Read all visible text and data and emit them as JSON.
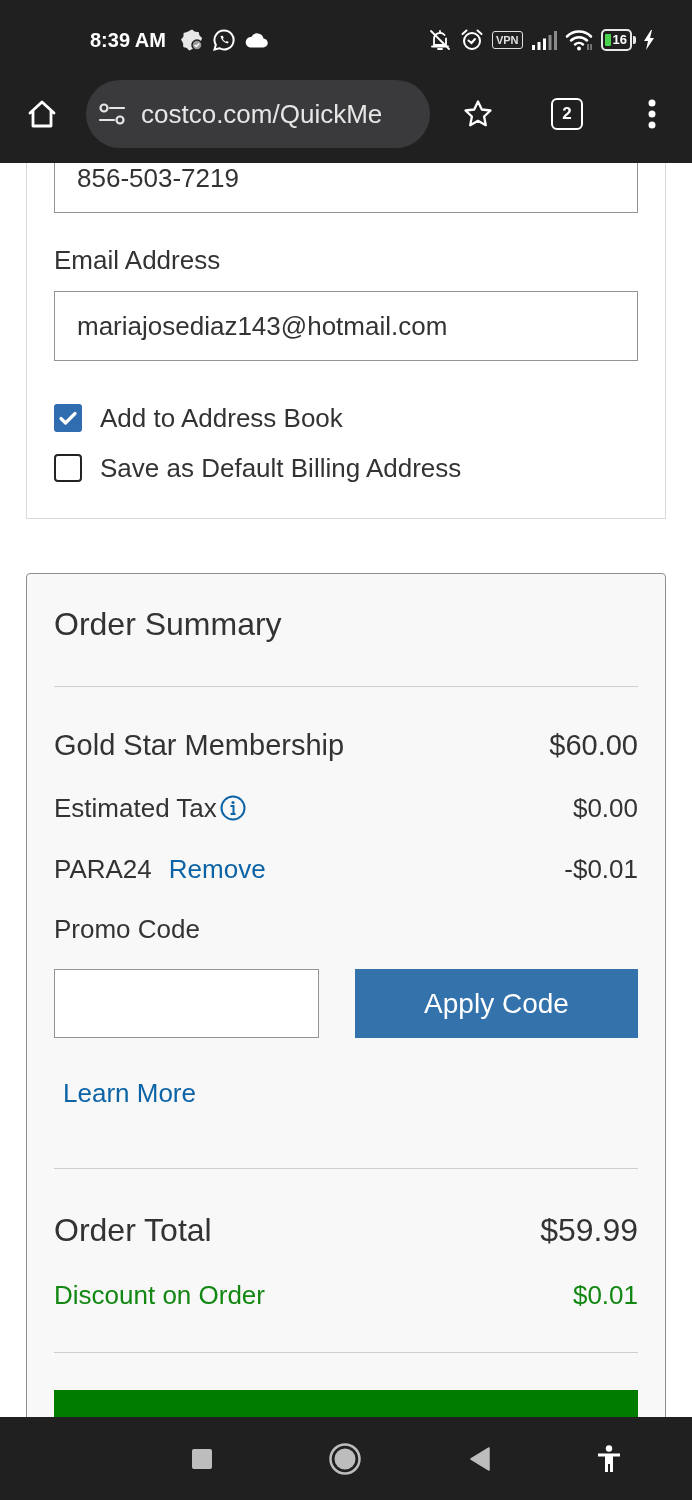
{
  "status_bar": {
    "time": "8:39 AM",
    "vpn": "VPN",
    "battery": "16"
  },
  "browser": {
    "url": "costco.com/QuickMe",
    "tab_count": "2"
  },
  "billing_form": {
    "phone": {
      "value": "856-503-7219"
    },
    "email": {
      "label": "Email Address",
      "value": "mariajosediaz143@hotmail.com"
    },
    "options": [
      {
        "label": "Add to Address Book",
        "checked": true
      },
      {
        "label": "Save as Default Billing Address",
        "checked": false
      }
    ]
  },
  "order_summary": {
    "title": "Order Summary",
    "lines": [
      {
        "kind": "item",
        "label": "Gold Star Membership",
        "amount": "$60.00"
      },
      {
        "kind": "tax",
        "label": "Estimated Tax",
        "amount": "$0.00"
      },
      {
        "kind": "promo",
        "label": "PARA24",
        "action": "Remove",
        "amount": "-$0.01"
      }
    ],
    "promo": {
      "label": "Promo Code",
      "button": "Apply Code",
      "link": "Learn More"
    },
    "total": {
      "label": "Order Total",
      "amount": "$59.99"
    },
    "discount": {
      "label": "Discount on Order",
      "amount": "$0.01"
    }
  }
}
